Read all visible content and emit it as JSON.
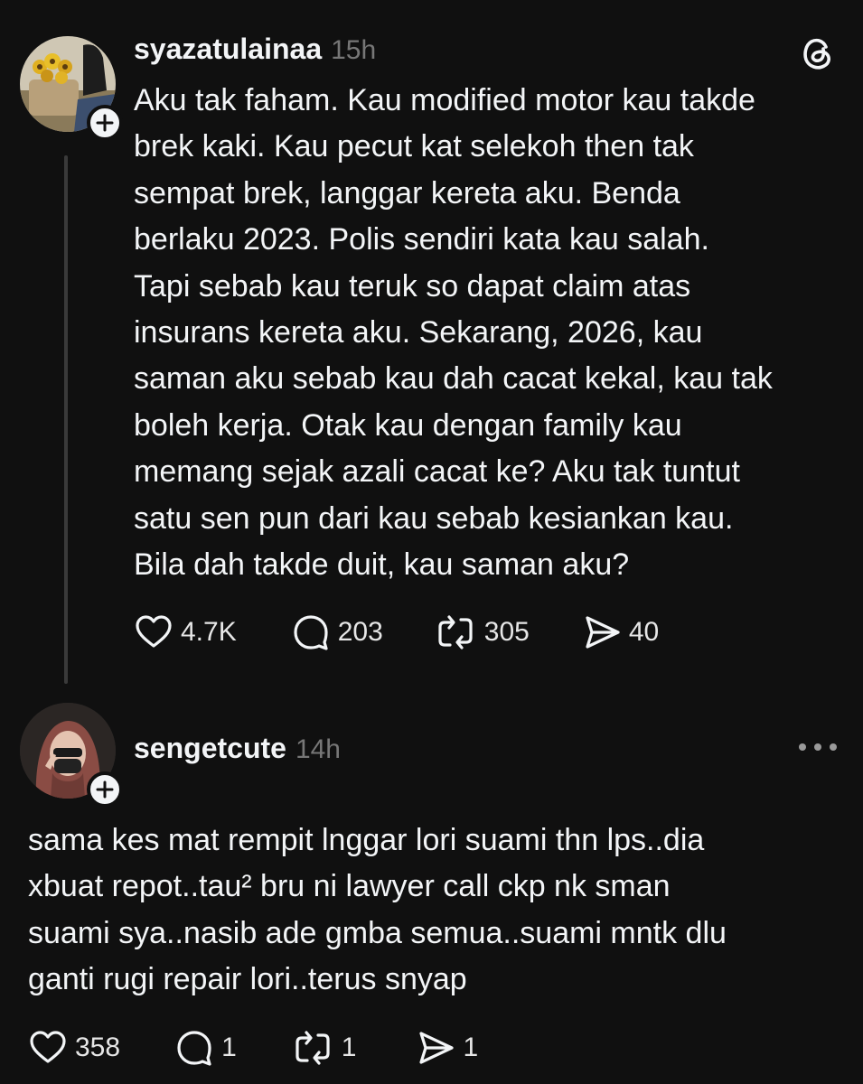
{
  "colors": {
    "background": "#101010",
    "text": "#f3f5f7",
    "muted": "#777777",
    "thread_line": "#3a3a3a"
  },
  "posts": [
    {
      "username": "syazatulainaa",
      "time": "15h",
      "text": "Aku tak faham. Kau modified motor kau takde\nbrek kaki. Kau pecut kat selekoh then tak\nsempat brek, langgar kereta aku. Benda\nberlaku 2023. Polis sendiri kata kau salah.\nTapi sebab kau teruk so dapat claim atas\ninsurans kereta aku. Sekarang, 2026, kau\nsaman aku sebab kau dah cacat kekal, kau tak\nboleh kerja. Otak kau dengan family kau\nmemang sejak azali cacat ke? Aku tak tuntut\nsatu sen pun dari kau sebab kesiankan kau.\nBila dah takde duit, kau saman aku?",
      "likes": "4.7K",
      "replies": "203",
      "reposts": "305",
      "shares": "40",
      "top_right_icon": "threads-logo-icon"
    },
    {
      "username": "sengetcute",
      "time": "14h",
      "text": "sama kes mat rempit lnggar lori suami thn lps..dia\nxbuat repot..tau² bru ni lawyer call ckp nk sman\nsuami sya..nasib ade gmba semua..suami mntk dlu\nganti rugi repair lori..terus snyap",
      "likes": "358",
      "replies": "1",
      "reposts": "1",
      "shares": "1",
      "top_right_icon": "more-options-icon"
    }
  ]
}
